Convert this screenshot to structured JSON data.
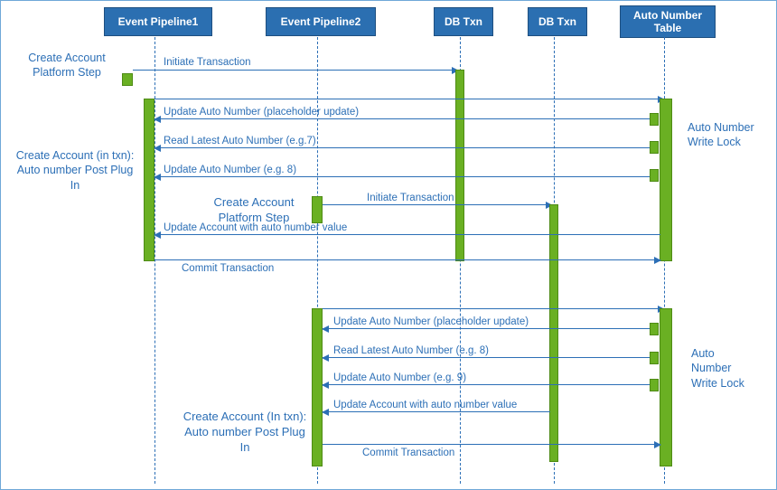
{
  "participants": {
    "ep1": "Event Pipeline1",
    "ep2": "Event Pipeline2",
    "db1": "DB Txn",
    "db2": "DB Txn",
    "ant": "Auto Number\nTable"
  },
  "side_labels": {
    "create_account_platform_step_1": "Create\nAccount\nPlatform\nStep",
    "create_account_auto_number_1": "Create Account (in\ntxn): Auto number\nPost Plug In",
    "auto_number_write_lock_1": "Auto Number\nWrite Lock",
    "create_account_platform_step_2": "Create Account\nPlatform Step",
    "create_account_auto_number_2": "Create Account (In\ntxn): Auto number\nPost Plug In",
    "auto_number_write_lock_2": "Auto\nNumber\nWrite\nLock"
  },
  "messages": {
    "m1": "Initiate Transaction",
    "m2": "Update Auto Number (placeholder update)",
    "m3": "Read Latest Auto Number (e.g.7)",
    "m4": "Update Auto Number (e.g. 8)",
    "m5": "Initiate Transaction",
    "m6": "Update Account with auto number value",
    "m7": "Commit Transaction",
    "m8": "Update Auto Number (placeholder update)",
    "m9": "Read Latest Auto Number (e.g. 8)",
    "m10": "Update Auto Number (e.g. 9)",
    "m11": "Update Account with auto number value",
    "m12": "Commit Transaction"
  },
  "chart_data": {
    "type": "sequence-diagram",
    "participants": [
      "Event Pipeline1",
      "Event Pipeline2",
      "DB Txn (1)",
      "DB Txn (2)",
      "Auto Number Table"
    ],
    "interactions": [
      {
        "from": "Event Pipeline1",
        "to": "DB Txn (1)",
        "label": "Initiate Transaction",
        "direction": "request"
      },
      {
        "from": "Event Pipeline1",
        "to": "Auto Number Table",
        "label": "Update Auto Number (placeholder update)",
        "direction": "request"
      },
      {
        "from": "Auto Number Table",
        "to": "Event Pipeline1",
        "label": "Read Latest Auto Number (e.g.7)",
        "direction": "response"
      },
      {
        "from": "Event Pipeline1",
        "to": "Auto Number Table",
        "label": "Update Auto Number (e.g. 8)",
        "direction": "request"
      },
      {
        "from": "Event Pipeline2",
        "to": "DB Txn (2)",
        "label": "Initiate Transaction",
        "direction": "request"
      },
      {
        "from": "Event Pipeline1",
        "to": "Auto Number Table",
        "label": "Update Account with auto number value",
        "direction": "request"
      },
      {
        "from": "Event Pipeline1",
        "to": "Auto Number Table",
        "label": "Commit Transaction",
        "direction": "request"
      },
      {
        "from": "Event Pipeline2",
        "to": "Auto Number Table",
        "label": "Update Auto Number (placeholder update)",
        "direction": "request"
      },
      {
        "from": "Auto Number Table",
        "to": "Event Pipeline2",
        "label": "Read Latest Auto Number (e.g. 8)",
        "direction": "response"
      },
      {
        "from": "Event Pipeline2",
        "to": "Auto Number Table",
        "label": "Update Auto Number (e.g. 9)",
        "direction": "request"
      },
      {
        "from": "Event Pipeline2",
        "to": "DB Txn (2)",
        "label": "Update Account with auto number value",
        "direction": "request"
      },
      {
        "from": "Event Pipeline2",
        "to": "Auto Number Table",
        "label": "Commit Transaction",
        "direction": "request"
      }
    ],
    "lock_regions": [
      {
        "on": "Auto Number Table",
        "label": "Auto Number Write Lock",
        "covers_interactions": [
          2,
          3,
          4,
          6,
          7
        ]
      },
      {
        "on": "Auto Number Table",
        "label": "Auto Number Write Lock",
        "covers_interactions": [
          8,
          9,
          10,
          12
        ]
      }
    ],
    "annotations": [
      {
        "attached_to": "Event Pipeline1",
        "label": "Create Account Platform Step"
      },
      {
        "attached_to": "Event Pipeline1",
        "label": "Create Account (in txn): Auto number Post Plug In"
      },
      {
        "attached_to": "Event Pipeline2",
        "label": "Create Account Platform Step"
      },
      {
        "attached_to": "Event Pipeline2",
        "label": "Create Account (In txn): Auto number Post Plug In"
      }
    ]
  }
}
